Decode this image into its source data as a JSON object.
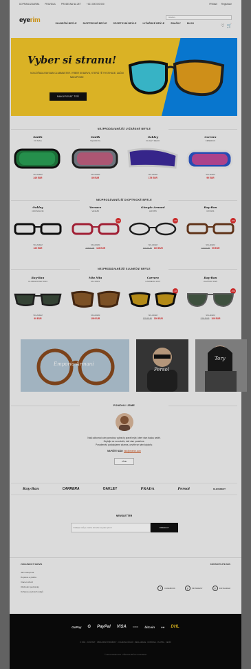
{
  "topbar": {
    "items": [
      "DOPRAVA ZDARMA",
      "PRAVIDLA",
      "PRODEJNA NA 2ET",
      "+421 000 000 000"
    ],
    "right": [
      "Přihlásit",
      "Registrace"
    ]
  },
  "header": {
    "logo_main": "eye",
    "logo_accent": "rim",
    "search_placeholder": "Hledat...",
    "nav": [
      "SLUNEČNÍ BRÝLE",
      "DIOPTRICKÉ BRÝLE",
      "SPORTOVNÍ BRÝLE",
      "LYŽAŘSKÉ BRÝLE",
      "ZNAČKY",
      "BLOG"
    ],
    "cart_icon": "cart-icon",
    "heart_icon": "heart-icon"
  },
  "hero": {
    "title": "Vyber si stranu!",
    "text": "NOVÁ ŘADA RAY-BAN CLUBMASTER. VYBER SI BARVU, KTERÁ TĚ VYSTIHUJE. ZAČNI NAKUPOVAT.",
    "cta": "NAKUPOVAT TEĎ",
    "colors": {
      "yellow": "#f3c72a",
      "blue": "#0a84e6"
    }
  },
  "sections": {
    "ski_title": "NEJPRODÁVANĚJŠÍ LYŽAŘSKÉ BRÝLE",
    "optic_title": "NEJPRODÁVANĚJŠÍ DIOPTRICKÉ BRÝLE",
    "sun_title": "NEJPRODÁVANĚJŠÍ SLUNEČNÍ BRÝLE"
  },
  "ski_products": [
    {
      "brand": "Smith",
      "model": "I/O MAG",
      "avail": "SKLADEM",
      "price": "249 EUR",
      "old": ""
    },
    {
      "brand": "Smith",
      "model": "SQUAD XL",
      "avail": "SKLADEM",
      "price": "89 EUR",
      "old": ""
    },
    {
      "brand": "Oakley",
      "model": "FLIGHT DECK",
      "avail": "SKLADEM",
      "price": "179 EUR",
      "old": ""
    },
    {
      "brand": "Carrera",
      "model": "KIMERICK",
      "avail": "SKLADEM",
      "price": "99 EUR",
      "old": ""
    }
  ],
  "optic_products": [
    {
      "brand": "Oakley",
      "model": "CROSSLINK",
      "avail": "SKLADEM",
      "price": "139 EUR",
      "old": "",
      "sale": ""
    },
    {
      "brand": "Versace",
      "model": "VE3186",
      "avail": "SKLADEM",
      "price": "149 EUR",
      "old": "169 EUR",
      "sale": "-12%"
    },
    {
      "brand": "Giorgio Armani",
      "model": "AR7055",
      "avail": "SKLADEM",
      "price": "109 EUR",
      "old": "129 EUR",
      "sale": "-16%"
    },
    {
      "brand": "Ray-Ban",
      "model": "RX5154",
      "avail": "SKLADEM",
      "price": "95 EUR",
      "old": "119 EUR",
      "sale": "-20%"
    }
  ],
  "sun_products": [
    {
      "brand": "Ray-Ban",
      "model": "CLUBMASTER 3016",
      "avail": "SKLADEM",
      "price": "99 EUR",
      "old": "",
      "sale": ""
    },
    {
      "brand": "Miu Miu",
      "model": "MU 08RS",
      "avail": "SKLADEM",
      "price": "199 EUR",
      "old": "",
      "sale": ""
    },
    {
      "brand": "Carrera",
      "model": "CARRERA 1007",
      "avail": "SKLADEM",
      "price": "159 EUR",
      "old": "179 EUR",
      "sale": "-11%"
    },
    {
      "brand": "Ray-Ban",
      "model": "AVIATOR 3025",
      "avail": "SKLADEM",
      "price": "109 EUR",
      "old": "129 EUR",
      "sale": "-15%"
    }
  ],
  "banners": [
    {
      "caption": "Emporio Armani"
    },
    {
      "caption": "Persol"
    },
    {
      "caption": "Tory"
    }
  ],
  "about": {
    "title": "POMOHLI JSME",
    "line1": "Naši odborníci vám pomohou vybrat ty pravé brýle, které vám budou sedět.",
    "line2": "Zeptejte se na cokoliv, rádi vám poradíme.",
    "line3": "Poradenství poskytujeme zdarma, ozvěte se nám kdykoliv.",
    "email_label": "NAPIŠTE NÁM:",
    "email": "info@eyerim.com",
    "button": "VÍCE"
  },
  "brands": [
    "Ray-Ban",
    "CARRERA",
    "OAKLEY",
    "PRADA",
    "Persol",
    "KLEVEREST"
  ],
  "newsletter": {
    "title": "NEWSLETTER",
    "placeholder": "Zadejte svůj e-mail a dozvíte se jako první",
    "button": "ODESLAT"
  },
  "footer": {
    "col1_title": "ZÁKAZNICKÝ SERVIS",
    "links": [
      "Jak nakupovat",
      "Doprava a platba",
      "Vrácení zboží",
      "Obchodní podmínky",
      "Ochrana osobních údajů"
    ],
    "col2_title": "KONTAKTUJTE NÁS",
    "social": [
      {
        "icon": "facebook-icon",
        "glyph": "f",
        "label": "FACEBOOK"
      },
      {
        "icon": "pinterest-icon",
        "glyph": "p",
        "label": "PINTEREST"
      },
      {
        "icon": "instagram-icon",
        "glyph": "◎",
        "label": "INSTAGRAM"
      }
    ],
    "payments": [
      "GoPay",
      "G",
      "PayPal",
      "VISA",
      "▭▭",
      "bitcoin",
      "●●",
      "DHL"
    ],
    "bottom_links": "O NÁS · KONTAKT · OBCHODNÍ PODMÍNKY · OCHRANA ÚDAJŮ · REKLAMACE · DOPRAVA · PLATBA · CENÍK",
    "copyright": "© 2016 EYERIM.COM · VŠECHNA PRÁVA VYHRAZENA"
  }
}
